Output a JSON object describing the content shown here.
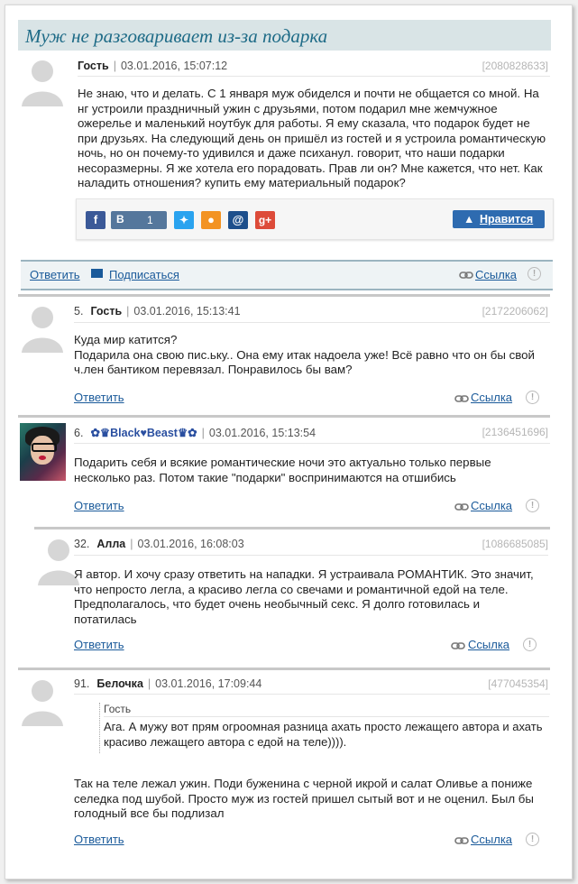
{
  "post": {
    "title": "Муж не разговаривает из-за подарка",
    "author": "Гость",
    "date": "03.01.2016, 15:07:12",
    "id": "[2080828633]",
    "text": "Не знаю, что и делать. С 1 января муж обиделся и почти не общается со мной. На нг устроили праздничный ужин с друзьями, потом подарил мне жемчужное ожерелье и маленький ноутбук для работы. Я ему сказала, что подарок будет не при друзьях. На следующий день он пришёл из гостей и я устроила романтическую ночь, но он почему-то удивился и даже психанул. говорит, что наши подарки несоразмерны. Я же хотела его порадовать. Прав ли он? Мне кажется, что нет. Как наладить отношения? купить ему материальный подарок?"
  },
  "share": {
    "vk_label": "В",
    "vk_count": "1",
    "like_label": "Нравится",
    "buttons": [
      {
        "name": "facebook-icon",
        "glyph": "f",
        "color": "#3b5998"
      },
      {
        "name": "twitter-icon",
        "glyph": "t",
        "color": "#2aa3ef"
      },
      {
        "name": "odnoklassniki-icon",
        "glyph": "ok",
        "color": "#f39322"
      },
      {
        "name": "mailru-icon",
        "glyph": "@",
        "color": "#1d4f8c"
      },
      {
        "name": "googleplus-icon",
        "glyph": "g+",
        "color": "#dd4b39"
      }
    ]
  },
  "actions": {
    "reply": "Ответить",
    "subscribe": "Подписаться",
    "link": "Ссылка"
  },
  "comments": [
    {
      "num": "5.",
      "author": "Гость",
      "date": "03.01.2016, 15:13:41",
      "id": "[2172206062]",
      "text": "Куда мир катится?\nПодарила она свою пис.ьку.. Она ему итак надоела уже! Всё равно что он бы свой ч.лен бантиком перевязал. Понравилось бы вам?"
    },
    {
      "num": "6.",
      "author": "✿♛Black♥Beast♛✿",
      "date": "03.01.2016, 15:13:54",
      "id": "[2136451696]",
      "text": "Подарить себя и всякие романтические ночи это актуально только первые несколько раз. Потом такие \"подарки\" воспринимаются на отшибись"
    },
    {
      "num": "32.",
      "author": "Алла",
      "date": "03.01.2016, 16:08:03",
      "id": "[1086685085]",
      "text": "Я автор. И хочу сразу ответить на нападки. Я устраивала РОМАНТИК. Это значит, что непросто легла, а красиво легла со свечами и романтичной едой на теле. Предполагалось, что будет очень необычный секс. Я долго готовилась и потатилась"
    },
    {
      "num": "91.",
      "author": "Белочка",
      "date": "03.01.2016, 17:09:44",
      "id": "[477045354]",
      "quote_author": "Гость",
      "quote_text": "Ага. А мужу вот прям огроомная разница ахать просто лежащего автора и ахать красиво лежащего автора с едой на теле)))).",
      "text": "Так на теле лежал ужин. Поди буженина с черной икрой и салат Оливье а пониже селедка под шубой. Просто муж из гостей пришел сытый вот и не оценил. Был бы голодный все бы подлизал"
    }
  ]
}
